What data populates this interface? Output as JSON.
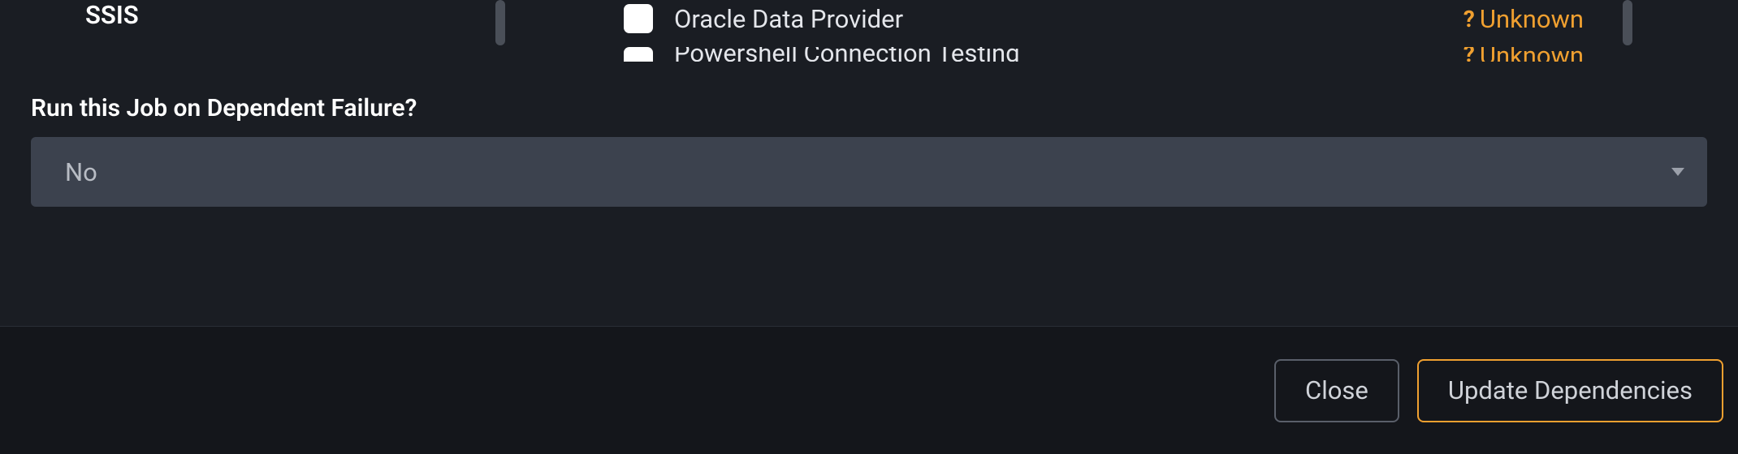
{
  "categories": {
    "left_item": "SSIS"
  },
  "dependencies": [
    {
      "label": "Oracle Data Provider",
      "status": "Unknown"
    },
    {
      "label": "Powershell Connection Testing",
      "status": "Unknown"
    }
  ],
  "form": {
    "run_on_failure_label": "Run this Job on Dependent Failure?",
    "run_on_failure_value": "No"
  },
  "footer": {
    "close_label": "Close",
    "update_label": "Update Dependencies"
  }
}
